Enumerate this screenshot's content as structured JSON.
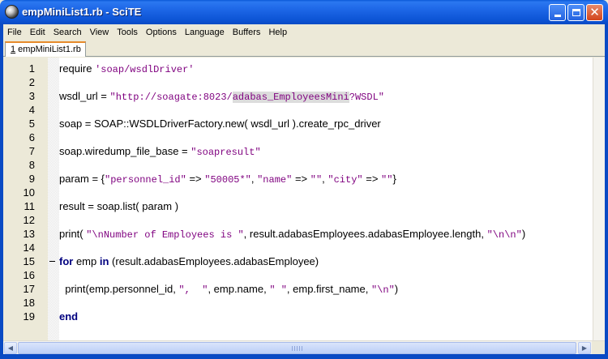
{
  "window": {
    "title": "empMiniList1.rb - SciTE"
  },
  "menu": [
    "File",
    "Edit",
    "Search",
    "View",
    "Tools",
    "Options",
    "Language",
    "Buffers",
    "Help"
  ],
  "tab": {
    "number": "1",
    "label": " empMiniList1.rb"
  },
  "lines": [
    {
      "n": "1"
    },
    {
      "n": "2"
    },
    {
      "n": "3"
    },
    {
      "n": "4"
    },
    {
      "n": "5"
    },
    {
      "n": "6"
    },
    {
      "n": "7"
    },
    {
      "n": "8"
    },
    {
      "n": "9"
    },
    {
      "n": "10"
    },
    {
      "n": "11"
    },
    {
      "n": "12"
    },
    {
      "n": "13"
    },
    {
      "n": "14"
    },
    {
      "n": "15"
    },
    {
      "n": "16"
    },
    {
      "n": "17"
    },
    {
      "n": "18"
    },
    {
      "n": "19"
    }
  ],
  "code": {
    "l1": {
      "a": "require ",
      "s1": "'soap/wsdlDriver'"
    },
    "l3": {
      "a": "wsdl_url = ",
      "s1": "\"http://soagate:8023/",
      "s2": "adabas_EmployeesMini",
      "s3": "?WSDL\""
    },
    "l5": {
      "a": "soap = SOAP::WSDLDriverFactory.new( wsdl_url ).create_rpc_driver"
    },
    "l7": {
      "a": "soap.wiredump_file_base = ",
      "s1": "\"soapresult\""
    },
    "l9": {
      "a": "param = {",
      "s1": "\"personnel_id\"",
      "b": " => ",
      "s2": "\"50005*\"",
      "c": ", ",
      "s3": "\"name\"",
      "d": " => ",
      "s4": "\"\"",
      "e": ", ",
      "s5": "\"city\"",
      "f": " => ",
      "s6": "\"\"",
      "g": "}"
    },
    "l11": {
      "a": "result = soap.list( param )"
    },
    "l13": {
      "a": "print( ",
      "s1": "\"\\nNumber of Employees is \"",
      "b": ", result.adabasEmployees.adabasEmployee.length, ",
      "s2": "\"\\n\\n\"",
      "c": ")"
    },
    "l15": {
      "kw1": "for",
      "a": " emp ",
      "kw2": "in",
      "b": " (result.adabasEmployees.adabasEmployee)"
    },
    "l17": {
      "a": "  print(emp.personnel_id, ",
      "s1": "\",  \"",
      "b": ", emp.name, ",
      "s2": "\" \"",
      "c": ", emp.first_name, ",
      "s3": "\"\\n\"",
      "d": ")"
    },
    "l19": {
      "kw1": "end"
    }
  },
  "colors": {
    "titlebar": "#0a58d8",
    "string": "#7f007f",
    "keyword": "#00007f",
    "gutter": "#ece9d8"
  }
}
